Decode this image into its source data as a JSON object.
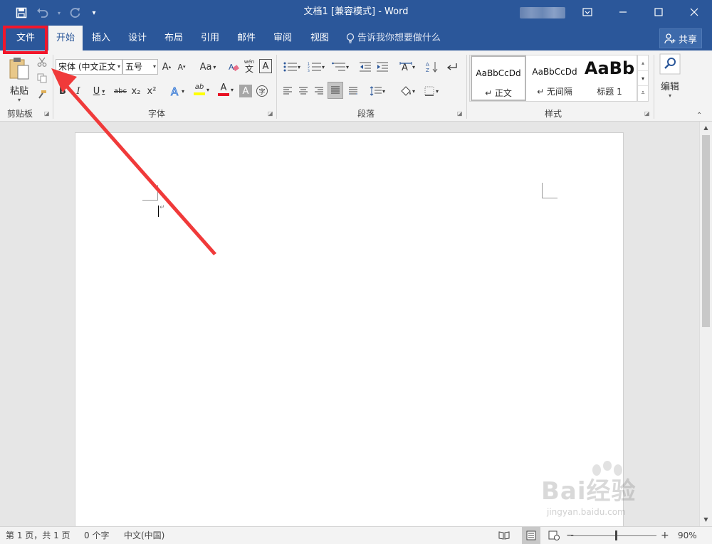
{
  "titlebar": {
    "title": "文档1 [兼容模式] - Word",
    "save_icon": "save-icon",
    "undo_icon": "undo-icon",
    "redo_icon": "redo-icon",
    "customize_icon": "customize-qat-icon",
    "minimize_icon": "ribbon-display-icon",
    "buttons": [
      "ribbon-display",
      "minimize",
      "maximize",
      "close"
    ]
  },
  "tabs": [
    {
      "label": "文件"
    },
    {
      "label": "开始"
    },
    {
      "label": "插入"
    },
    {
      "label": "设计"
    },
    {
      "label": "布局"
    },
    {
      "label": "引用"
    },
    {
      "label": "邮件"
    },
    {
      "label": "审阅"
    },
    {
      "label": "视图"
    }
  ],
  "tellme": "告诉我你想要做什么",
  "share": "共享",
  "ribbon": {
    "clipboard": {
      "paste_label": "粘贴",
      "group_label": "剪贴板"
    },
    "font": {
      "font_name": "宋体 (中文正文",
      "font_size": "五号",
      "aa_label": "Aa",
      "wen_label": "wén",
      "wen_char": "文",
      "a_boxed": "A",
      "bold": "B",
      "italic": "I",
      "underline": "U",
      "strike": "abc",
      "subscript": "x₂",
      "superscript": "x²",
      "highlight": "ab",
      "font_color": "A",
      "char_shading": "A",
      "enclose": "字",
      "grow": "A",
      "shrink": "A",
      "group_label": "字体"
    },
    "paragraph": {
      "group_label": "段落"
    },
    "styles": {
      "items": [
        {
          "sample": "AaBbCcDd",
          "name": "↵ 正文"
        },
        {
          "sample": "AaBbCcDd",
          "name": "↵ 无间隔"
        },
        {
          "sample": "AaBb",
          "name": "标题 1"
        }
      ],
      "group_label": "样式"
    },
    "editing": {
      "label": "编辑"
    }
  },
  "document": {
    "paragraph_mark": "↵"
  },
  "statusbar": {
    "page_info": "第 1 页，共 1 页",
    "word_count": "0 个字",
    "language": "中文(中国)",
    "zoom_minus": "−",
    "zoom_plus": "+",
    "zoom": "90%"
  },
  "watermark": {
    "main": "Bai经验",
    "sub": "jingyan.baidu.com"
  },
  "colors": {
    "accent": "#2b579a",
    "highlight_box": "#f2162a",
    "arrow": "#f03a3a",
    "font_color_bar": "#e81123",
    "highlight_bar": "#ffff00"
  }
}
